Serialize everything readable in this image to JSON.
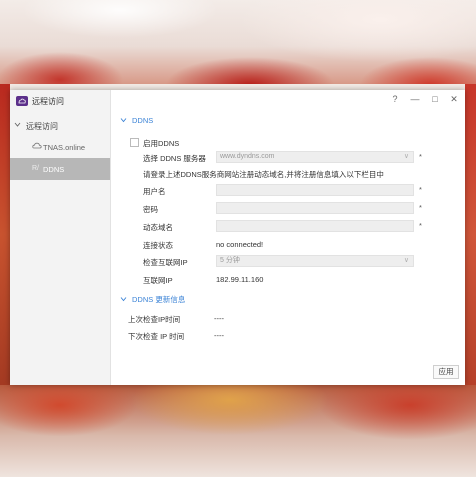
{
  "app": {
    "title": "远程访问"
  },
  "window_controls": {
    "help": "?",
    "minimize": "—",
    "maximize": "□",
    "close": "✕"
  },
  "sidebar": {
    "group_label": "远程访问",
    "items": [
      {
        "label": "TNAS.online",
        "icon": "cloud-icon"
      },
      {
        "label": "DDNS",
        "icon_text": "R/",
        "selected": true
      }
    ]
  },
  "sections": {
    "ddns": {
      "title": "DDNS"
    },
    "update_info": {
      "title": "DDNS 更新信息"
    }
  },
  "form": {
    "enable_label": "启用DDNS",
    "provider_label": "选择 DDNS 服务器",
    "provider_value": "www.dyndns.com",
    "instruction": "请登录上述DDNS服务商网站注册动态域名,并将注册信息填入以下栏目中",
    "username_label": "用户名",
    "password_label": "密码",
    "domain_label": "动态域名",
    "status_label": "连接状态",
    "status_value": "no connected!",
    "interval_label": "检查互联网IP",
    "interval_value": "5 分钟",
    "ip_label": "互联网IP",
    "ip_value": "182.99.11.160",
    "required_mark": "*"
  },
  "update": {
    "last_check_label": "上次检查IP时间",
    "last_check_value": "----",
    "next_check_label": "下次检查 IP 时间",
    "next_check_value": "----"
  },
  "buttons": {
    "apply": "应用"
  }
}
